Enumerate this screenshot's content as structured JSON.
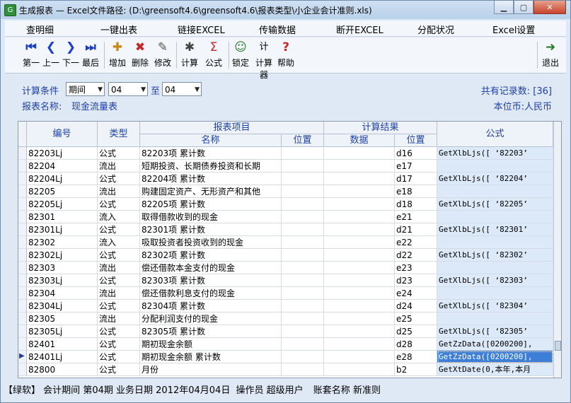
{
  "window": {
    "title": "生成报表 — Excel文件路径: (D:\\greensoft4.6\\greensoft4.6\\报表类型\\小企业会计准则.xls)",
    "app_icon": "green-app-icon"
  },
  "menu": [
    "查明细",
    "一键出表",
    "链接EXCEL",
    "传输数据",
    "断开EXCEL",
    "分配状况",
    "Excel设置"
  ],
  "toolbar": [
    {
      "label": "第一",
      "icon": "first-icon",
      "glyph": "⏮"
    },
    {
      "label": "上一",
      "icon": "prev-icon",
      "glyph": "❮"
    },
    {
      "label": "下一",
      "icon": "next-icon",
      "glyph": "❯"
    },
    {
      "label": "最后",
      "icon": "last-icon",
      "glyph": "⏭"
    },
    {
      "label": "增加",
      "icon": "add-icon",
      "glyph": "✚"
    },
    {
      "label": "删除",
      "icon": "delete-icon",
      "glyph": "✖"
    },
    {
      "label": "修改",
      "icon": "edit-icon",
      "glyph": "✎"
    },
    {
      "label": "计算",
      "icon": "calculate-icon",
      "glyph": "✱"
    },
    {
      "label": "公式",
      "icon": "formula-icon",
      "glyph": "Σ"
    },
    {
      "label": "锁定",
      "icon": "lock-icon",
      "glyph": "☺"
    },
    {
      "label": "计算器",
      "icon": "calculator-icon",
      "glyph": "计"
    },
    {
      "label": "帮助",
      "icon": "help-icon",
      "glyph": "?"
    },
    {
      "label": "退出",
      "icon": "exit-icon",
      "glyph": "➜"
    }
  ],
  "info": {
    "calc_condition_label": "计算条件",
    "period_type": "期间",
    "from_period": "04",
    "to_label": "至",
    "to_period": "04",
    "report_name_label": "报表名称:",
    "report_name": "现金流量表",
    "record_count_label": "共有记录数: [36]",
    "currency_label": "本位币:人民币"
  },
  "grid": {
    "headers": {
      "code": "编号",
      "type": "类型",
      "report_item": "报表项目",
      "name": "名称",
      "position": "位置",
      "calc_result": "计算结果",
      "data": "数据",
      "result_position": "位置",
      "formula": "公式"
    },
    "rows": [
      {
        "code": "82203Lj",
        "type": "公式",
        "name": "82203项 累计数",
        "pos": "",
        "data": "",
        "rpos": "d16",
        "formula": "GetXlbLjs([ ‘82203’"
      },
      {
        "code": "82204",
        "type": "流出",
        "name": "短期投资、长期债券投资和长期",
        "pos": "",
        "data": "",
        "rpos": "e17",
        "formula": ""
      },
      {
        "code": "82204Lj",
        "type": "公式",
        "name": "82204项 累计数",
        "pos": "",
        "data": "",
        "rpos": "d17",
        "formula": "GetXlbLjs([ ‘82204’"
      },
      {
        "code": "82205",
        "type": "流出",
        "name": "购建固定资产、无形资产和其他",
        "pos": "",
        "data": "",
        "rpos": "e18",
        "formula": ""
      },
      {
        "code": "82205Lj",
        "type": "公式",
        "name": "82205项 累计数",
        "pos": "",
        "data": "",
        "rpos": "d18",
        "formula": "GetXlbLjs([ ‘82205’"
      },
      {
        "code": "82301",
        "type": "流入",
        "name": "取得借款收到的现金",
        "pos": "",
        "data": "",
        "rpos": "e21",
        "formula": ""
      },
      {
        "code": "82301Lj",
        "type": "公式",
        "name": "82301项 累计数",
        "pos": "",
        "data": "",
        "rpos": "d21",
        "formula": "GetXlbLjs([ ‘82301’"
      },
      {
        "code": "82302",
        "type": "流入",
        "name": "吸取投资者投资收到的现金",
        "pos": "",
        "data": "",
        "rpos": "e22",
        "formula": ""
      },
      {
        "code": "82302Lj",
        "type": "公式",
        "name": "82302项 累计数",
        "pos": "",
        "data": "",
        "rpos": "d22",
        "formula": "GetXlbLjs([ ‘82302’"
      },
      {
        "code": "82303",
        "type": "流出",
        "name": "偿还借款本金支付的现金",
        "pos": "",
        "data": "",
        "rpos": "e23",
        "formula": ""
      },
      {
        "code": "82303Lj",
        "type": "公式",
        "name": "82303项 累计数",
        "pos": "",
        "data": "",
        "rpos": "d23",
        "formula": "GetXlbLjs([ ‘82303’"
      },
      {
        "code": "82304",
        "type": "流出",
        "name": "偿还借款利息支付的现金",
        "pos": "",
        "data": "",
        "rpos": "e24",
        "formula": ""
      },
      {
        "code": "82304Lj",
        "type": "公式",
        "name": "82304项 累计数",
        "pos": "",
        "data": "",
        "rpos": "d24",
        "formula": "GetXlbLjs([ ‘82304’"
      },
      {
        "code": "82305",
        "type": "流出",
        "name": "分配利润支付的现金",
        "pos": "",
        "data": "",
        "rpos": "e25",
        "formula": ""
      },
      {
        "code": "82305Lj",
        "type": "公式",
        "name": "82305项 累计数",
        "pos": "",
        "data": "",
        "rpos": "d25",
        "formula": "GetXlbLjs([ ‘82305’"
      },
      {
        "code": "82401",
        "type": "公式",
        "name": "期初现金余额",
        "pos": "",
        "data": "",
        "rpos": "d28",
        "formula": "GetZzData([0200200],"
      },
      {
        "code": "82401Lj",
        "type": "公式",
        "name": "期初现金余额 累计数",
        "pos": "",
        "data": "",
        "rpos": "e28",
        "formula": "GetZzData([0200200],",
        "selected": true
      },
      {
        "code": "82800",
        "type": "公式",
        "name": "月份",
        "pos": "",
        "data": "",
        "rpos": "b2",
        "formula": "GetXtDate(0,本年,本月"
      }
    ]
  },
  "status": {
    "brand": "【绿软】",
    "period_label": "会计期间",
    "period_value": "第04期",
    "biz_date_label": "业务日期",
    "biz_date_value": "2012年04月04日",
    "operator_label": "操作员",
    "operator_value": "超级用户",
    "account_label": "账套名称",
    "account_value": "新准则"
  },
  "colors": {
    "accent": "#1f3fa6",
    "selection": "#3d7fd8",
    "formula_bg": "#dce9f8"
  }
}
